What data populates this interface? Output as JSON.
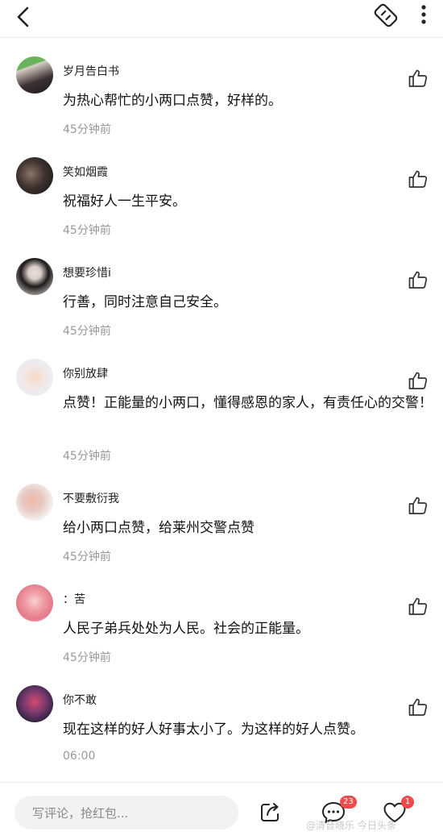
{
  "comments": [
    {
      "username": "岁月告白书",
      "text": "为热心帮忙的小两口点赞，好样的。",
      "time": "45分钟前"
    },
    {
      "username": "笑如烟霞",
      "text": "祝福好人一生平安。",
      "time": "45分钟前"
    },
    {
      "username": "想要珍惜i",
      "text": "行善，同时注意自己安全。",
      "time": "45分钟前"
    },
    {
      "username": "你别放肆",
      "text": "点赞！正能量的小两口，懂得感恩的家人，有责任心的交警！",
      "time": "45分钟前"
    },
    {
      "username": "不要敷衍我",
      "text": "给小两口点赞，给莱州交警点赞",
      "time": "45分钟前"
    },
    {
      "username": "：苦",
      "text": "人民子弟兵处处为人民。社会的正能量。",
      "time": "45分钟前"
    },
    {
      "username": "你不敢",
      "text": "现在这样的好人好事太小了。为这样的好人点赞。",
      "time": "06:00"
    }
  ],
  "bottom_bar": {
    "input_placeholder": "写评论，抢红包...",
    "comment_count": "23",
    "favorite_count": "1"
  },
  "watermark": "@清音晓乐  今日头条",
  "icons": {
    "back": "back-arrow-icon",
    "share_top": "share-link-icon",
    "more": "more-vertical-icon",
    "like": "thumbs-up-icon",
    "share_bottom": "share-icon",
    "comment": "comment-bubble-icon",
    "favorite": "heart-icon"
  },
  "colors": {
    "badge": "#f04a4a",
    "time": "#999999",
    "background": "#ffffff"
  }
}
